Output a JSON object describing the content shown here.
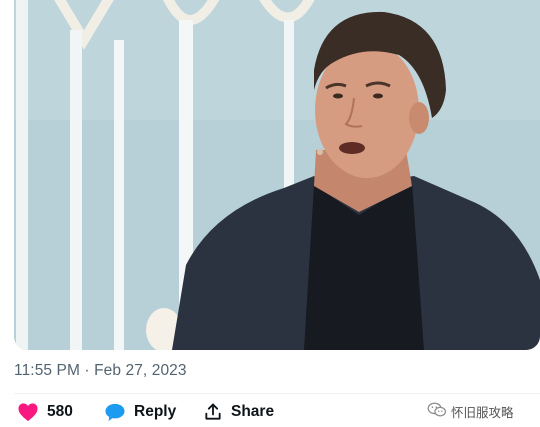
{
  "tweet": {
    "timestamp": "11:55 PM · Feb 27, 2023",
    "media_alt": "video frame of a man speaking on stage"
  },
  "actions": {
    "like_count": "580",
    "reply_label": "Reply",
    "share_label": "Share"
  },
  "watermark": {
    "text": "怀旧服攻略"
  },
  "colors": {
    "like": "#f91880",
    "reply": "#1d9bf0",
    "meta_text": "#536471"
  },
  "icons": {
    "like": "heart-icon",
    "reply": "speech-bubble-icon",
    "share": "share-arrow-icon",
    "watermark": "wechat-icon"
  }
}
